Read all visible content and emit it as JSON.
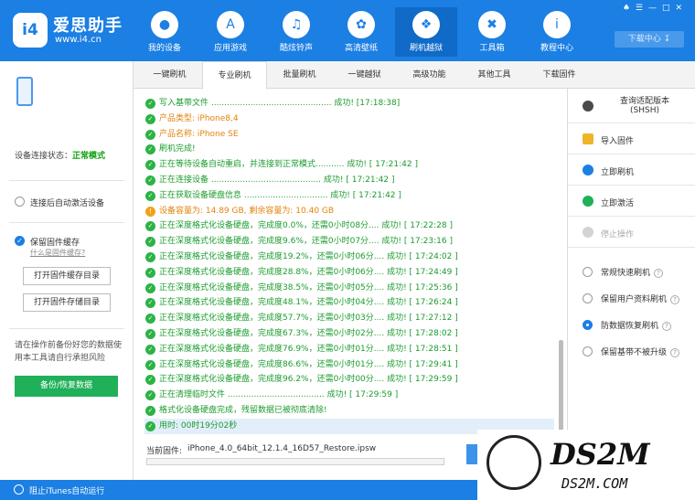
{
  "app": {
    "brand": "爱思助手",
    "url": "www.i4.cn",
    "logo_text": "i4",
    "download_center": "下载中心"
  },
  "nav": [
    {
      "label": "我的设备",
      "icon": "apple-icon",
      "glyph": ""
    },
    {
      "label": "应用游戏",
      "icon": "appstore-icon",
      "glyph": "A"
    },
    {
      "label": "酷炫铃声",
      "icon": "bell-icon",
      "glyph": "🔔"
    },
    {
      "label": "高清壁纸",
      "icon": "flower-icon",
      "glyph": "✿"
    },
    {
      "label": "刷机越狱",
      "icon": "dropbox-icon",
      "glyph": "❖"
    },
    {
      "label": "工具箱",
      "icon": "tools-icon",
      "glyph": "✖"
    },
    {
      "label": "教程中心",
      "icon": "info-icon",
      "glyph": "i"
    }
  ],
  "tabs": [
    "一键刷机",
    "专业刷机",
    "批量刷机",
    "一键越狱",
    "高级功能",
    "其他工具",
    "下载固件"
  ],
  "left": {
    "status_label": "设备连接状态：",
    "status_value": "正常模式",
    "auto_activate": "连接后自动激活设备",
    "keep_cache": "保留固件缓存",
    "what_cache": "什么是固件缓存?",
    "open_cache_dir": "打开固件缓存目录",
    "open_store_dir": "打开固件存储目录",
    "warning": "请在操作前备份好您的数据使用本工具请自行承担风险",
    "backup_button": "备份/恢复数据"
  },
  "log": [
    {
      "text": "写入基带文件 .............................................. 成功! [17:18:38]",
      "color": "green",
      "type": "ok"
    },
    {
      "text": "产品类型: iPhone8,4",
      "color": "orange",
      "type": "ok"
    },
    {
      "text": "产品名称: iPhone SE",
      "color": "orange",
      "type": "ok"
    },
    {
      "text": "刷机完成!",
      "color": "green",
      "type": "ok"
    },
    {
      "text": "正在等待设备自动重启，并连接到正常模式........... 成功! [ 17:21:42 ]",
      "color": "green",
      "type": "ok"
    },
    {
      "text": "正在连接设备 .......................................... 成功! [ 17:21:42 ]",
      "color": "green",
      "type": "ok"
    },
    {
      "text": "正在获取设备硬盘信息 ................................ 成功! [ 17:21:42 ]",
      "color": "green",
      "type": "ok"
    },
    {
      "text": "设备容量为: 14.89 GB, 剩余容量为: 10.40 GB",
      "color": "orange",
      "type": "warn"
    },
    {
      "text": "正在深度格式化设备硬盘，完成度0.0%，还需0小时08分.... 成功! [ 17:22:28 ]",
      "color": "green",
      "type": "ok"
    },
    {
      "text": "正在深度格式化设备硬盘，完成度9.6%，还需0小时07分.... 成功! [ 17:23:16 ]",
      "color": "green",
      "type": "ok"
    },
    {
      "text": "正在深度格式化设备硬盘，完成度19.2%，还需0小时06分.... 成功! [ 17:24:02 ]",
      "color": "green",
      "type": "ok"
    },
    {
      "text": "正在深度格式化设备硬盘，完成度28.8%，还需0小时06分.... 成功! [ 17:24:49 ]",
      "color": "green",
      "type": "ok"
    },
    {
      "text": "正在深度格式化设备硬盘，完成度38.5%，还需0小时05分.... 成功! [ 17:25:36 ]",
      "color": "green",
      "type": "ok"
    },
    {
      "text": "正在深度格式化设备硬盘，完成度48.1%，还需0小时04分.... 成功! [ 17:26:24 ]",
      "color": "green",
      "type": "ok"
    },
    {
      "text": "正在深度格式化设备硬盘，完成度57.7%，还需0小时03分.... 成功! [ 17:27:12 ]",
      "color": "green",
      "type": "ok"
    },
    {
      "text": "正在深度格式化设备硬盘，完成度67.3%，还需0小时02分.... 成功! [ 17:28:02 ]",
      "color": "green",
      "type": "ok"
    },
    {
      "text": "正在深度格式化设备硬盘，完成度76.9%，还需0小时01分.... 成功! [ 17:28:51 ]",
      "color": "green",
      "type": "ok"
    },
    {
      "text": "正在深度格式化设备硬盘，完成度86.6%，还需0小时01分.... 成功! [ 17:29:41 ]",
      "color": "green",
      "type": "ok"
    },
    {
      "text": "正在深度格式化设备硬盘，完成度96.2%，还需0小时00分.... 成功! [ 17:29:59 ]",
      "color": "green",
      "type": "ok"
    },
    {
      "text": "正在清理临时文件 ..................................... 成功! [ 17:29:59 ]",
      "color": "green",
      "type": "ok"
    },
    {
      "text": "格式化设备硬盘完成，残留数据已被彻底清除!",
      "color": "green",
      "type": "ok"
    },
    {
      "text": "用时: 00时19分02秒",
      "color": "green",
      "type": "ok",
      "highlight": true
    }
  ],
  "firmware": {
    "label": "当前固件:",
    "name": "iPhone_4.0_64bit_12.1.4_16D57_Restore.ipsw",
    "progress": 0
  },
  "right": {
    "query": "查询适配版本\n(SHSH)",
    "import": "导入固件",
    "flash_now": "立即刷机",
    "activate_now": "立即激活",
    "stop": "停止操作",
    "options": [
      {
        "label": "常规快速刷机",
        "checked": false
      },
      {
        "label": "保留用户资料刷机",
        "checked": false
      },
      {
        "label": "防数据恢复刷机",
        "checked": true
      },
      {
        "label": "保留基带不被升级",
        "checked": false
      }
    ]
  },
  "bottom": {
    "text": "阻止iTunes自动运行"
  },
  "watermark": {
    "title": "DS2M",
    "sub": "DS2M.COM"
  },
  "colors": {
    "primary": "#1b7fe3",
    "success": "#20b05a",
    "warn": "#e3830c"
  }
}
